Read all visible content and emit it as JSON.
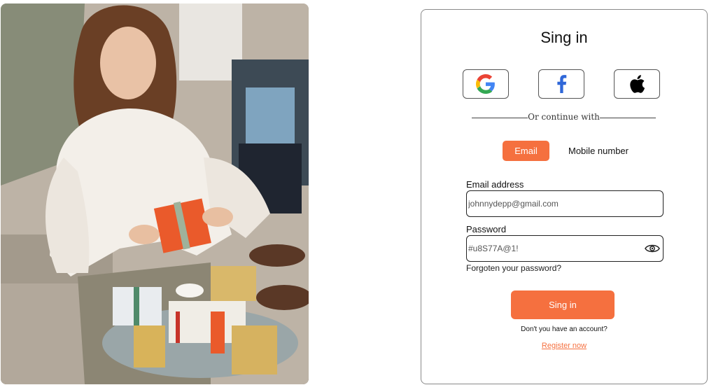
{
  "hero_image": {
    "alt": "Woman in white knit sweater holding an orange gift box over a table of wrapped gifts"
  },
  "signin": {
    "title": "Sing in",
    "social": [
      {
        "name": "google",
        "icon": "google-icon"
      },
      {
        "name": "facebook",
        "icon": "facebook-icon"
      },
      {
        "name": "apple",
        "icon": "apple-icon"
      }
    ],
    "divider_text": "Or continue with",
    "tabs": {
      "email_label": "Email",
      "mobile_label": "Mobile number",
      "active": "email"
    },
    "email": {
      "label": "Email address",
      "value": "johnnydepp@gmail.com"
    },
    "password": {
      "label": "Password",
      "value": "#u8S77A@1!",
      "toggle_icon": "eye-icon"
    },
    "forgot_label": "Forgoten your password?",
    "submit_label": "Sing in",
    "no_account_text": "Don't you have an account?",
    "register_label": "Register now"
  },
  "colors": {
    "accent": "#f5703f",
    "border": "#8a8a8a"
  }
}
